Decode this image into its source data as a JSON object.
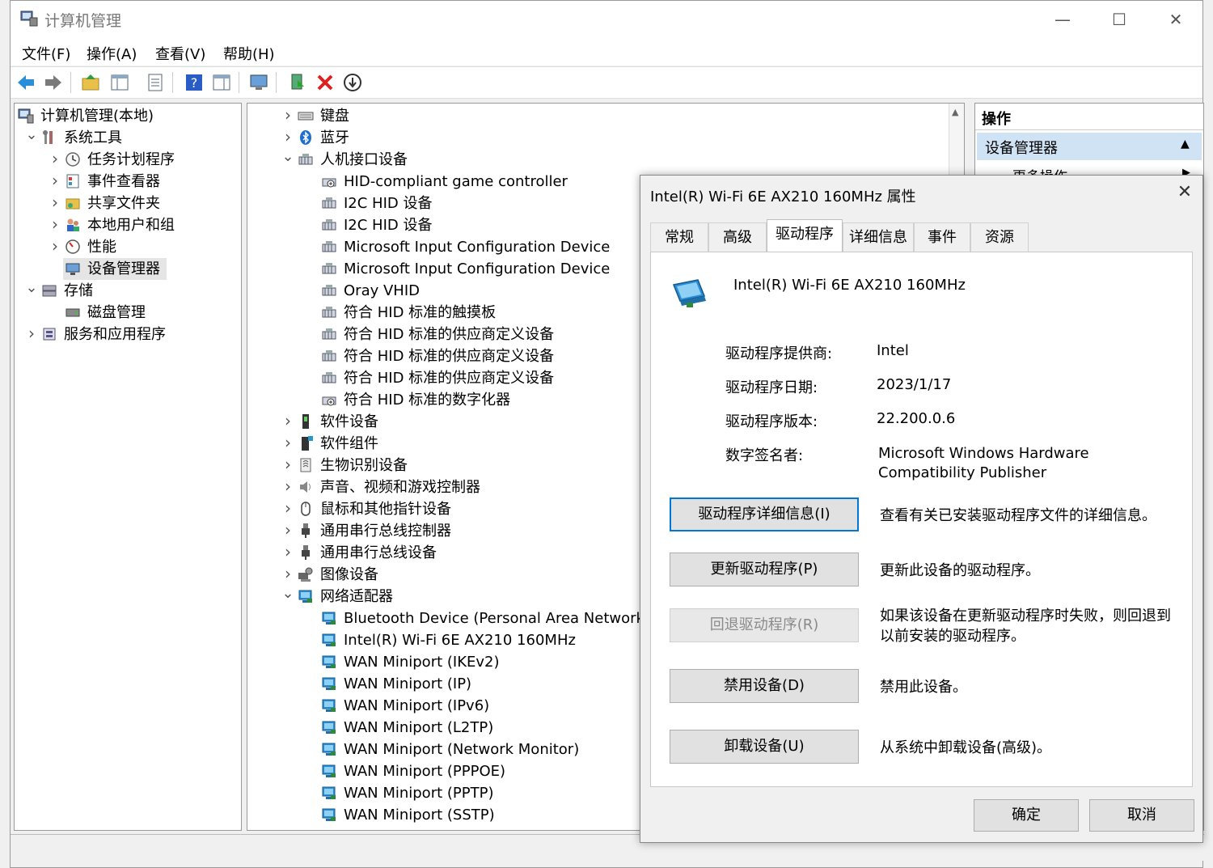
{
  "window": {
    "title": "计算机管理"
  },
  "menu": [
    "文件(F)",
    "操作(A)",
    "查看(V)",
    "帮助(H)"
  ],
  "left_tree": [
    {
      "label": "计算机管理(本地)",
      "level": 0,
      "chev": "",
      "icon": "computer-icon"
    },
    {
      "label": "系统工具",
      "level": 1,
      "chev": "v",
      "icon": "tools-icon"
    },
    {
      "label": "任务计划程序",
      "level": 2,
      "chev": ">",
      "icon": "clock-icon"
    },
    {
      "label": "事件查看器",
      "level": 2,
      "chev": ">",
      "icon": "event-viewer-icon"
    },
    {
      "label": "共享文件夹",
      "level": 2,
      "chev": ">",
      "icon": "shared-folder-icon"
    },
    {
      "label": "本地用户和组",
      "level": 2,
      "chev": ">",
      "icon": "users-icon"
    },
    {
      "label": "性能",
      "level": 2,
      "chev": ">",
      "icon": "performance-icon"
    },
    {
      "label": "设备管理器",
      "level": 2,
      "chev": "",
      "icon": "device-manager-icon",
      "selected": true
    },
    {
      "label": "存储",
      "level": 1,
      "chev": "v",
      "icon": "storage-icon"
    },
    {
      "label": "磁盘管理",
      "level": 2,
      "chev": "",
      "icon": "disk-icon"
    },
    {
      "label": "服务和应用程序",
      "level": 1,
      "chev": ">",
      "icon": "services-icon"
    }
  ],
  "device_tree": [
    {
      "label": "键盘",
      "level": 0,
      "chev": ">",
      "icon": "keyboard-icon"
    },
    {
      "label": "蓝牙",
      "level": 0,
      "chev": ">",
      "icon": "bluetooth-icon"
    },
    {
      "label": "人机接口设备",
      "level": 0,
      "chev": "v",
      "icon": "hid-icon"
    },
    {
      "label": "HID-compliant game controller",
      "level": 1,
      "chev": "",
      "icon": "hid-game-icon"
    },
    {
      "label": "I2C HID 设备",
      "level": 1,
      "chev": "",
      "icon": "hid-icon"
    },
    {
      "label": "I2C HID 设备",
      "level": 1,
      "chev": "",
      "icon": "hid-icon"
    },
    {
      "label": "Microsoft Input Configuration Device",
      "level": 1,
      "chev": "",
      "icon": "hid-icon"
    },
    {
      "label": "Microsoft Input Configuration Device",
      "level": 1,
      "chev": "",
      "icon": "hid-icon"
    },
    {
      "label": "Oray VHID",
      "level": 1,
      "chev": "",
      "icon": "hid-icon"
    },
    {
      "label": "符合 HID 标准的触摸板",
      "level": 1,
      "chev": "",
      "icon": "hid-icon"
    },
    {
      "label": "符合 HID 标准的供应商定义设备",
      "level": 1,
      "chev": "",
      "icon": "hid-icon"
    },
    {
      "label": "符合 HID 标准的供应商定义设备",
      "level": 1,
      "chev": "",
      "icon": "hid-icon"
    },
    {
      "label": "符合 HID 标准的供应商定义设备",
      "level": 1,
      "chev": "",
      "icon": "hid-icon"
    },
    {
      "label": "符合 HID 标准的数字化器",
      "level": 1,
      "chev": "",
      "icon": "hid-game-icon"
    },
    {
      "label": "软件设备",
      "level": 0,
      "chev": ">",
      "icon": "software-device-icon"
    },
    {
      "label": "软件组件",
      "level": 0,
      "chev": ">",
      "icon": "software-component-icon"
    },
    {
      "label": "生物识别设备",
      "level": 0,
      "chev": ">",
      "icon": "biometric-icon"
    },
    {
      "label": "声音、视频和游戏控制器",
      "level": 0,
      "chev": ">",
      "icon": "speaker-icon"
    },
    {
      "label": "鼠标和其他指针设备",
      "level": 0,
      "chev": ">",
      "icon": "mouse-icon"
    },
    {
      "label": "通用串行总线控制器",
      "level": 0,
      "chev": ">",
      "icon": "usb-icon"
    },
    {
      "label": "通用串行总线设备",
      "level": 0,
      "chev": ">",
      "icon": "usb-icon"
    },
    {
      "label": "图像设备",
      "level": 0,
      "chev": ">",
      "icon": "camera-icon"
    },
    {
      "label": "网络适配器",
      "level": 0,
      "chev": "v",
      "icon": "network-icon"
    },
    {
      "label": "Bluetooth Device (Personal Area Network)",
      "level": 1,
      "chev": "",
      "icon": "network-icon"
    },
    {
      "label": "Intel(R) Wi-Fi 6E AX210 160MHz",
      "level": 1,
      "chev": "",
      "icon": "network-icon"
    },
    {
      "label": "WAN Miniport (IKEv2)",
      "level": 1,
      "chev": "",
      "icon": "network-icon"
    },
    {
      "label": "WAN Miniport (IP)",
      "level": 1,
      "chev": "",
      "icon": "network-icon"
    },
    {
      "label": "WAN Miniport (IPv6)",
      "level": 1,
      "chev": "",
      "icon": "network-icon"
    },
    {
      "label": "WAN Miniport (L2TP)",
      "level": 1,
      "chev": "",
      "icon": "network-icon"
    },
    {
      "label": "WAN Miniport (Network Monitor)",
      "level": 1,
      "chev": "",
      "icon": "network-icon"
    },
    {
      "label": "WAN Miniport (PPPOE)",
      "level": 1,
      "chev": "",
      "icon": "network-icon"
    },
    {
      "label": "WAN Miniport (PPTP)",
      "level": 1,
      "chev": "",
      "icon": "network-icon"
    },
    {
      "label": "WAN Miniport (SSTP)",
      "level": 1,
      "chev": "",
      "icon": "network-icon"
    }
  ],
  "actions": {
    "header": "操作",
    "section": "设备管理器",
    "more": "更多操作"
  },
  "dialog": {
    "title": "Intel(R) Wi-Fi 6E AX210 160MHz 属性",
    "tabs": [
      "常规",
      "高级",
      "驱动程序",
      "详细信息",
      "事件",
      "资源"
    ],
    "active_tab": "驱动程序",
    "device_name": "Intel(R) Wi-Fi 6E AX210 160MHz",
    "props": [
      {
        "label": "驱动程序提供商:",
        "value": "Intel"
      },
      {
        "label": "驱动程序日期:",
        "value": "2023/1/17"
      },
      {
        "label": "驱动程序版本:",
        "value": "22.200.0.6"
      },
      {
        "label": "数字签名者:",
        "value": "Microsoft Windows Hardware Compatibility Publisher"
      }
    ],
    "buttons": [
      {
        "label": "驱动程序详细信息(I)",
        "desc": "查看有关已安装驱动程序文件的详细信息。",
        "state": "focus"
      },
      {
        "label": "更新驱动程序(P)",
        "desc": "更新此设备的驱动程序。",
        "state": "normal"
      },
      {
        "label": "回退驱动程序(R)",
        "desc": "如果该设备在更新驱动程序时失败，则回退到以前安装的驱动程序。",
        "state": "disabled"
      },
      {
        "label": "禁用设备(D)",
        "desc": "禁用此设备。",
        "state": "normal"
      },
      {
        "label": "卸载设备(U)",
        "desc": "从系统中卸载设备(高级)。",
        "state": "normal"
      }
    ],
    "ok": "确定",
    "cancel": "取消"
  },
  "colors": {
    "accent": "#0078d7",
    "selection": "#e5e5e5",
    "action_header": "#cfe3f5",
    "network_icon": "#2a8fd8"
  }
}
